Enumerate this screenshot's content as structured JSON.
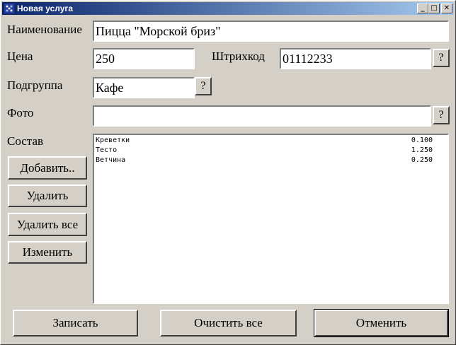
{
  "window": {
    "title": "Новая услуга"
  },
  "title_buttons": {
    "minimize": "_",
    "maximize": "□",
    "close": "✕"
  },
  "fields": {
    "name": {
      "label": "Наименование",
      "value": "Пицца \"Морской бриз\""
    },
    "price": {
      "label": "Цена",
      "value": "250"
    },
    "barcode": {
      "label": "Штрихкод",
      "value": "01112233",
      "lookup": "?"
    },
    "subgroup": {
      "label": "Подгруппа",
      "value": "Кафе",
      "lookup": "?"
    },
    "photo": {
      "label": "Фото",
      "value": "",
      "lookup": "?"
    }
  },
  "composition": {
    "label": "Состав",
    "items": [
      {
        "name": "Креветки",
        "qty": "0.100"
      },
      {
        "name": "Тесто",
        "qty": "1.250"
      },
      {
        "name": "Ветчина",
        "qty": "0.250"
      }
    ],
    "buttons": {
      "add": "Добавить..",
      "delete": "Удалить",
      "delete_all": "Удалить все",
      "edit": "Изменить"
    }
  },
  "footer": {
    "save": "Записать",
    "clear_all": "Очистить все",
    "cancel": "Отменить"
  }
}
